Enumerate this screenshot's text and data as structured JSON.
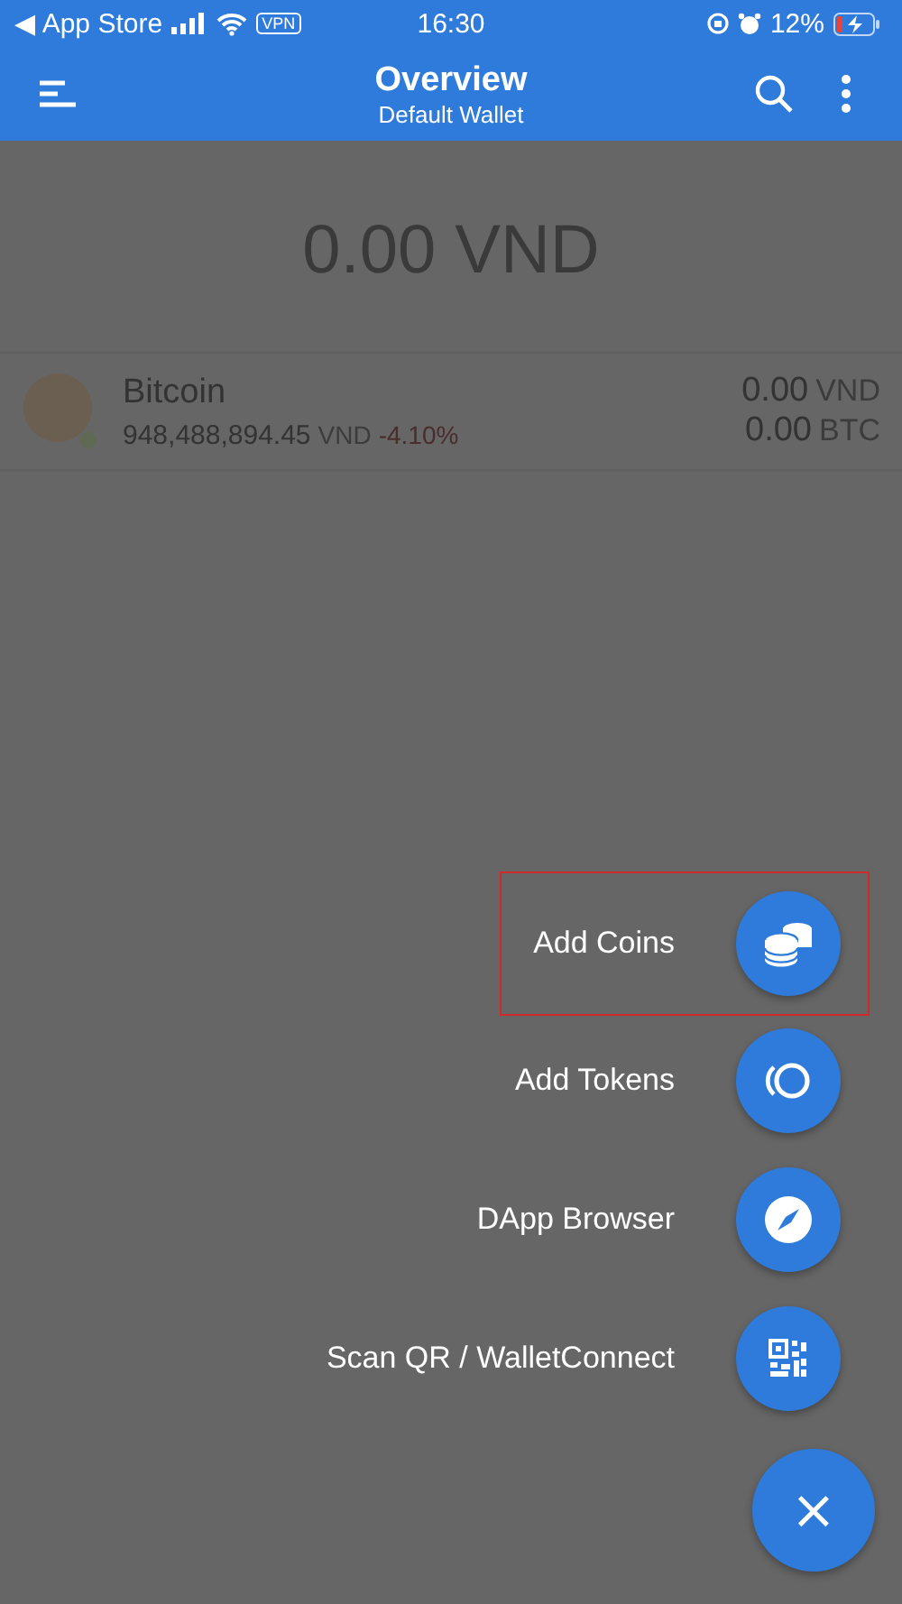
{
  "status_bar": {
    "back_label": "◀ App Store",
    "vpn": "VPN",
    "time": "16:30",
    "battery": "12%"
  },
  "header": {
    "title": "Overview",
    "subtitle": "Default Wallet"
  },
  "balance": "0.00 VND",
  "assets": [
    {
      "name": "Bitcoin",
      "price": "948,488,894.45",
      "price_unit": "VND",
      "change": "-4.10%",
      "fiat_value": "0.00",
      "fiat_unit": "VND",
      "amount": "0.00",
      "amount_unit": "BTC"
    }
  ],
  "actions": [
    {
      "label": "Add Coins",
      "kind": "coins",
      "highlighted": true
    },
    {
      "label": "Add Tokens",
      "kind": "tokens",
      "highlighted": false
    },
    {
      "label": "DApp Browser",
      "kind": "compass",
      "highlighted": false
    },
    {
      "label": "Scan QR / WalletConnect",
      "kind": "qr",
      "highlighted": false
    }
  ],
  "close_button": "×"
}
